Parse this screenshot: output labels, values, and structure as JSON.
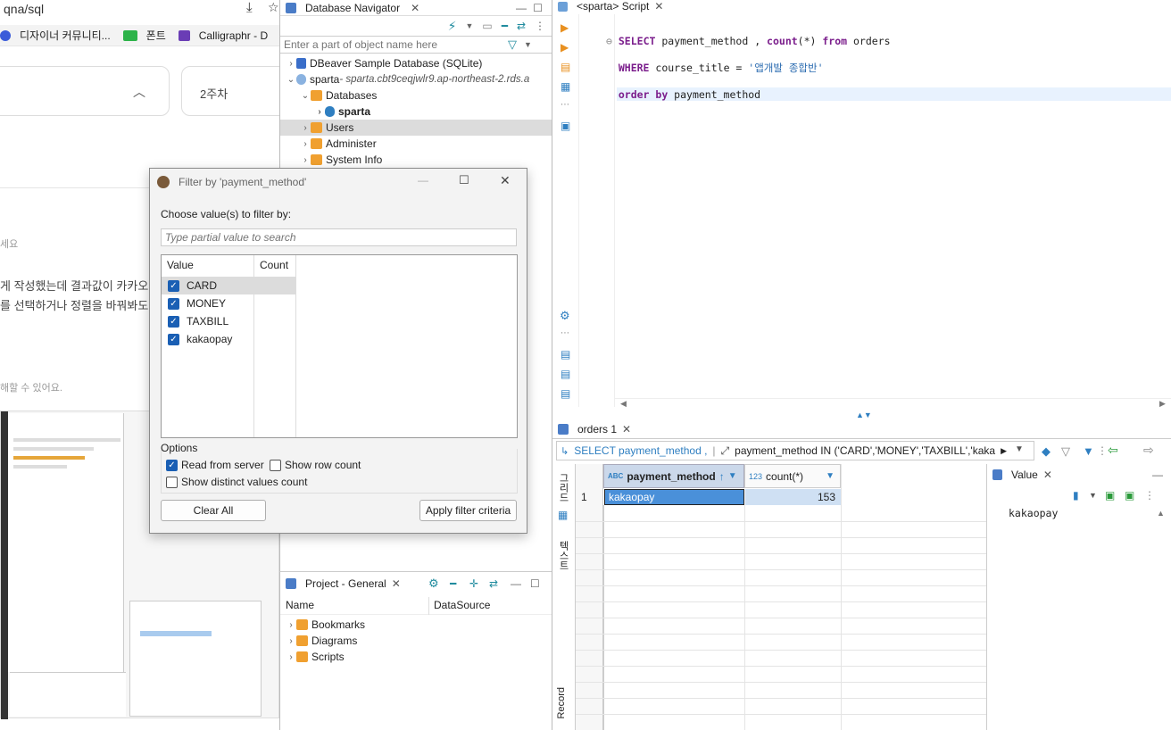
{
  "browser": {
    "url": "qna/sql",
    "bookmarks": [
      "디자이너 커뮤니티...",
      "폰트",
      "Calligraphr - D"
    ],
    "week_chip": "2주차",
    "hint_text": "세요",
    "post_line1": "게 작성했는데 결과값이 카카오페",
    "post_line2": "를 선택하거나 정렬을 바꿔봐도 그",
    "footer_hint": "해할 수 있어요."
  },
  "navigator": {
    "tab_title": "Database Navigator",
    "filter_placeholder": "Enter a part of object name here",
    "items": [
      {
        "label": "DBeaver Sample Database (SQLite)"
      },
      {
        "label": "sparta",
        "sub": " - sparta.cbt9ceqjwlr9.ap-northeast-2.rds.a"
      },
      {
        "label": "Databases"
      },
      {
        "label": "sparta"
      },
      {
        "label": "Users"
      },
      {
        "label": "Administer"
      },
      {
        "label": "System Info"
      }
    ]
  },
  "project": {
    "tab_title": "Project - General",
    "col_name": "Name",
    "col_datasource": "DataSource",
    "items": [
      "Bookmarks",
      "Diagrams",
      "Scripts"
    ]
  },
  "editor": {
    "tab_title": "<sparta> Script",
    "sql": {
      "l1_kw1": "SELECT",
      "l1_rest": " payment_method , ",
      "l1_kw2": "count",
      "l1_rest2": "(*) ",
      "l1_kw3": "from",
      "l1_rest3": " orders",
      "l2_kw": "WHERE",
      "l2_rest": " course_title = ",
      "l2_str": "'앱개발 종합반'",
      "l3_kw": "order by",
      "l3_rest": " payment_method"
    }
  },
  "results": {
    "tab_title": "orders 1",
    "query_chip": "SELECT payment_method ,",
    "filter_text": "payment_method IN ('CARD','MONEY','TAXBILL','kaka",
    "side_tab_grid": "그리드",
    "side_tab_text": "텍스트",
    "side_tab_record": "Record",
    "columns": [
      "payment_method",
      "count(*)"
    ],
    "col_type_1": "ABC",
    "col_type_2": "123",
    "rows": [
      {
        "num": "1",
        "payment_method": "kakaopay",
        "count": "153"
      }
    ],
    "value_panel_title": "Value",
    "value_panel_content": "kakaopay"
  },
  "dialog": {
    "title": "Filter by 'payment_method'",
    "prompt": "Choose value(s) to filter by:",
    "search_placeholder": "Type partial value to search",
    "col_value": "Value",
    "col_count": "Count",
    "values": [
      {
        "label": "CARD",
        "checked": true
      },
      {
        "label": "MONEY",
        "checked": true
      },
      {
        "label": "TAXBILL",
        "checked": true
      },
      {
        "label": "kakaopay",
        "checked": true
      }
    ],
    "options_label": "Options",
    "opt_read_server": "Read from server",
    "opt_show_row_count": "Show row count",
    "opt_distinct": "Show distinct values count",
    "clear_all": "Clear All",
    "apply": "Apply filter criteria"
  },
  "colors": {
    "accent": "#1a5fb4",
    "keyword": "#7b1e8c",
    "string": "#2a6bb0",
    "folder": "#f0a030",
    "selected_row": "#a9cbee"
  }
}
